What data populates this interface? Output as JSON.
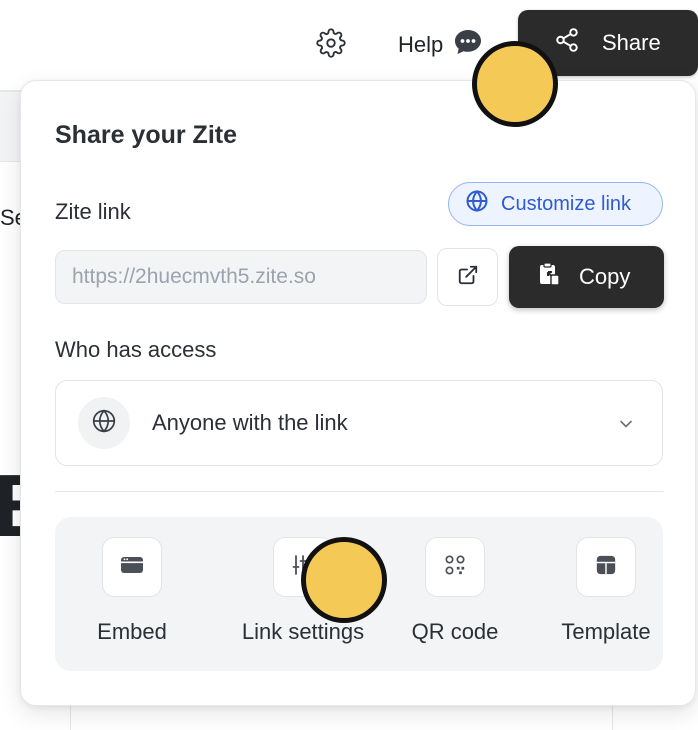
{
  "toolbar": {
    "help_label": "Help",
    "share_label": "Share"
  },
  "background": {
    "partial_text": "Se",
    "partial_glyph": "E"
  },
  "share_popover": {
    "title": "Share your Zite",
    "zite_link_label": "Zite link",
    "customize_link_label": "Customize link",
    "link_url": "https://2huecmvth5.zite.so",
    "copy_label": "Copy",
    "who_has_access_label": "Who has access",
    "access_value": "Anyone with the link",
    "options": [
      {
        "label": "Embed",
        "icon": "embed-icon"
      },
      {
        "label": "Link settings",
        "icon": "sliders-icon"
      },
      {
        "label": "QR code",
        "icon": "qr-code-icon"
      },
      {
        "label": "Template",
        "icon": "template-icon"
      }
    ]
  },
  "colors": {
    "dark_button": "#2b2b2b",
    "accent_blue": "#2f5bd3",
    "marker_yellow": "#f5c955"
  }
}
